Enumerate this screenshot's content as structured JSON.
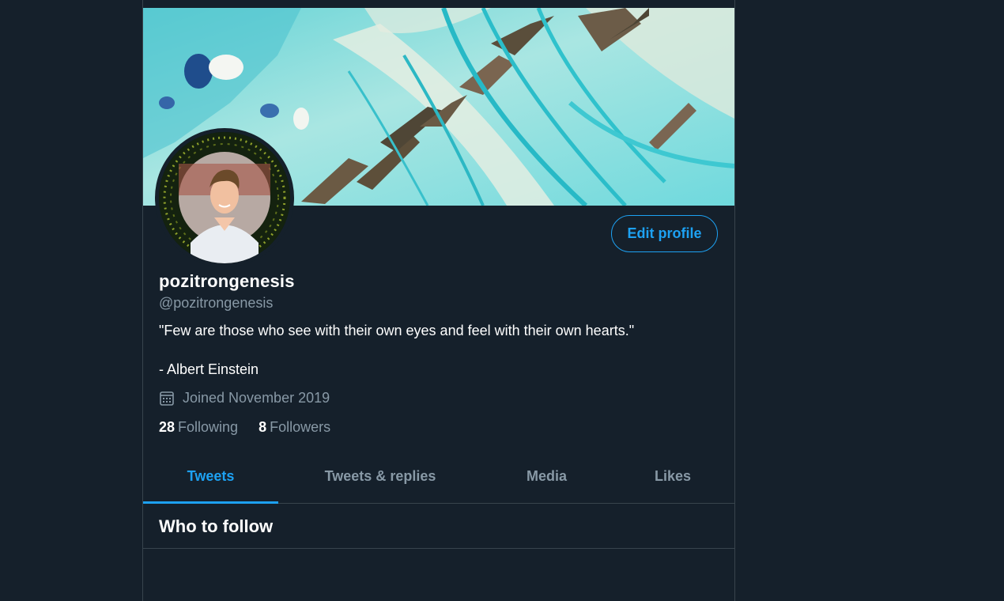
{
  "profile": {
    "display_name": "pozitrongenesis",
    "handle": "@pozitrongenesis",
    "bio_line1": "\"Few are those who see with their own eyes and feel with their own hearts.\"",
    "bio_line2": "- Albert Einstein",
    "joined": "Joined November 2019",
    "following_count": "28",
    "following_label": "Following",
    "followers_count": "8",
    "followers_label": "Followers",
    "edit_button": "Edit profile"
  },
  "tabs": [
    {
      "label": "Tweets",
      "active": true
    },
    {
      "label": "Tweets & replies",
      "active": false
    },
    {
      "label": "Media",
      "active": false
    },
    {
      "label": "Likes",
      "active": false
    }
  ],
  "section": {
    "who_to_follow": "Who to follow"
  },
  "colors": {
    "background": "#15202b",
    "accent": "#1da1f2",
    "muted": "#8899a6",
    "border": "#38444d"
  },
  "icons": {
    "joined": "calendar-icon"
  }
}
